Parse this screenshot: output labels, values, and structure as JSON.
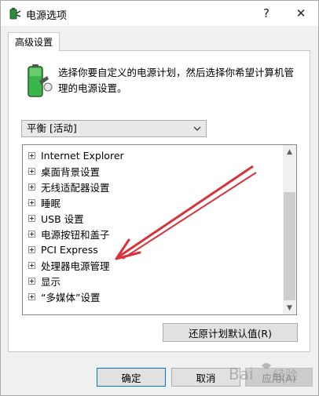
{
  "window": {
    "title": "电源选项",
    "help_glyph": "?",
    "close_glyph": "✕"
  },
  "tab": {
    "label": "高级设置"
  },
  "description": "选择你要自定义的电源计划，然后选择你希望计算机管理的电源设置。",
  "plan_select": {
    "value": "平衡 [活动]"
  },
  "tree_items": [
    "Internet Explorer",
    "桌面背景设置",
    "无线适配器设置",
    "睡眠",
    "USB 设置",
    "电源按钮和盖子",
    "PCI Express",
    "处理器电源管理",
    "显示",
    "“多媒体”设置"
  ],
  "buttons": {
    "restore": "还原计划默认值(R)",
    "ok": "确定",
    "cancel": "取消",
    "apply": "应用(A)"
  },
  "colors": {
    "annotation_arrow": "#d6343b",
    "ok_border": "#0078d7"
  },
  "watermark": {
    "logo": "Baidu经验"
  }
}
